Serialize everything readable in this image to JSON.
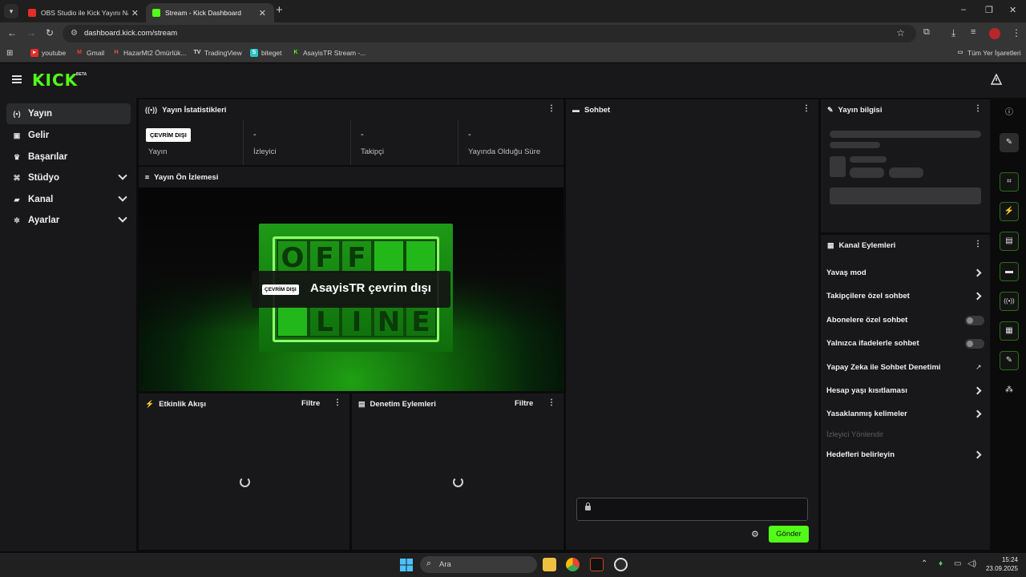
{
  "browser": {
    "tabs": [
      {
        "title": "OBS Studio ile Kick Yayını Nasıl",
        "favicon_color": "#e52d27",
        "close": "✕"
      },
      {
        "title": "Stream - Kick Dashboard",
        "favicon_color": "#53fc18",
        "close": "✕"
      }
    ],
    "new_tab": "+",
    "window_controls": {
      "minimize": "–",
      "maximize": "❐",
      "close": "✕"
    },
    "nav": {
      "back": "←",
      "forward": "→",
      "reload": "↻"
    },
    "url": "dashboard.kick.com/stream",
    "bookmarks": [
      "youtube",
      "Gmail",
      "HazarMt2 Ömürlük...",
      "TradingView",
      "biteget",
      "AsayisTR Stream -..."
    ],
    "all_bookmarks": "Tüm Yer İşaretleri"
  },
  "app": {
    "logo": "KICK",
    "logo_badge": "BETA",
    "accent": "#53fc18"
  },
  "sidebar": {
    "items": [
      {
        "label": "Yayın",
        "icon": "broadcast-icon",
        "glyph": "(•)"
      },
      {
        "label": "Gelir",
        "icon": "revenue-icon",
        "glyph": "▣"
      },
      {
        "label": "Başarılar",
        "icon": "trophy-icon",
        "glyph": "♛"
      },
      {
        "label": "Stüdyo",
        "icon": "studio-icon",
        "glyph": "⌘"
      },
      {
        "label": "Kanal",
        "icon": "channel-icon",
        "glyph": "▰"
      },
      {
        "label": "Ayarlar",
        "icon": "settings-icon",
        "glyph": "✲"
      }
    ]
  },
  "stats": {
    "title": "Yayın İstatistikleri",
    "status_badge": "ÇEVRİM DIŞI",
    "cells": [
      {
        "value": "",
        "label": "Yayın"
      },
      {
        "value": "-",
        "label": "İzleyici"
      },
      {
        "value": "-",
        "label": "Takipçi"
      },
      {
        "value": "-",
        "label": "Yayında Olduğu Süre"
      }
    ]
  },
  "preview": {
    "title": "Yayın Ön İzlemesi",
    "badge": "ÇEVRİM DIŞI",
    "offline_text": "AsayisTR çevrim dışı",
    "sign_letters": [
      "O",
      "F",
      "F",
      "",
      "",
      "L",
      "I",
      "N",
      "E"
    ]
  },
  "activity": {
    "title": "Etkinlik Akışı",
    "filter": "Filtre"
  },
  "moderation": {
    "title": "Denetim Eylemleri",
    "filter": "Filtre"
  },
  "chat": {
    "title": "Sohbet",
    "send": "Gönder"
  },
  "stream_info": {
    "title": "Yayın bilgisi"
  },
  "channel_actions": {
    "title": "Kanal Eylemleri",
    "items": [
      {
        "label": "Yavaş mod",
        "control": "chevron"
      },
      {
        "label": "Takipçilere özel sohbet",
        "control": "chevron"
      },
      {
        "label": "Abonelere özel sohbet",
        "control": "toggle"
      },
      {
        "label": "Yalnızca ifadelerle sohbet",
        "control": "toggle"
      },
      {
        "label": "Yapay Zeka ile Sohbet Denetimi",
        "control": "external"
      },
      {
        "label": "Hesap yaşı kısıtlaması",
        "control": "chevron"
      },
      {
        "label": "Yasaklanmış kelimeler",
        "control": "chevron"
      },
      {
        "label": "İzleyici Yönlendir",
        "control": "disabled"
      },
      {
        "label": "Hedefleri belirleyin",
        "control": "chevron"
      }
    ]
  },
  "taskbar": {
    "search_placeholder": "Ara",
    "time": "15:24",
    "date": "23.09.2025"
  }
}
